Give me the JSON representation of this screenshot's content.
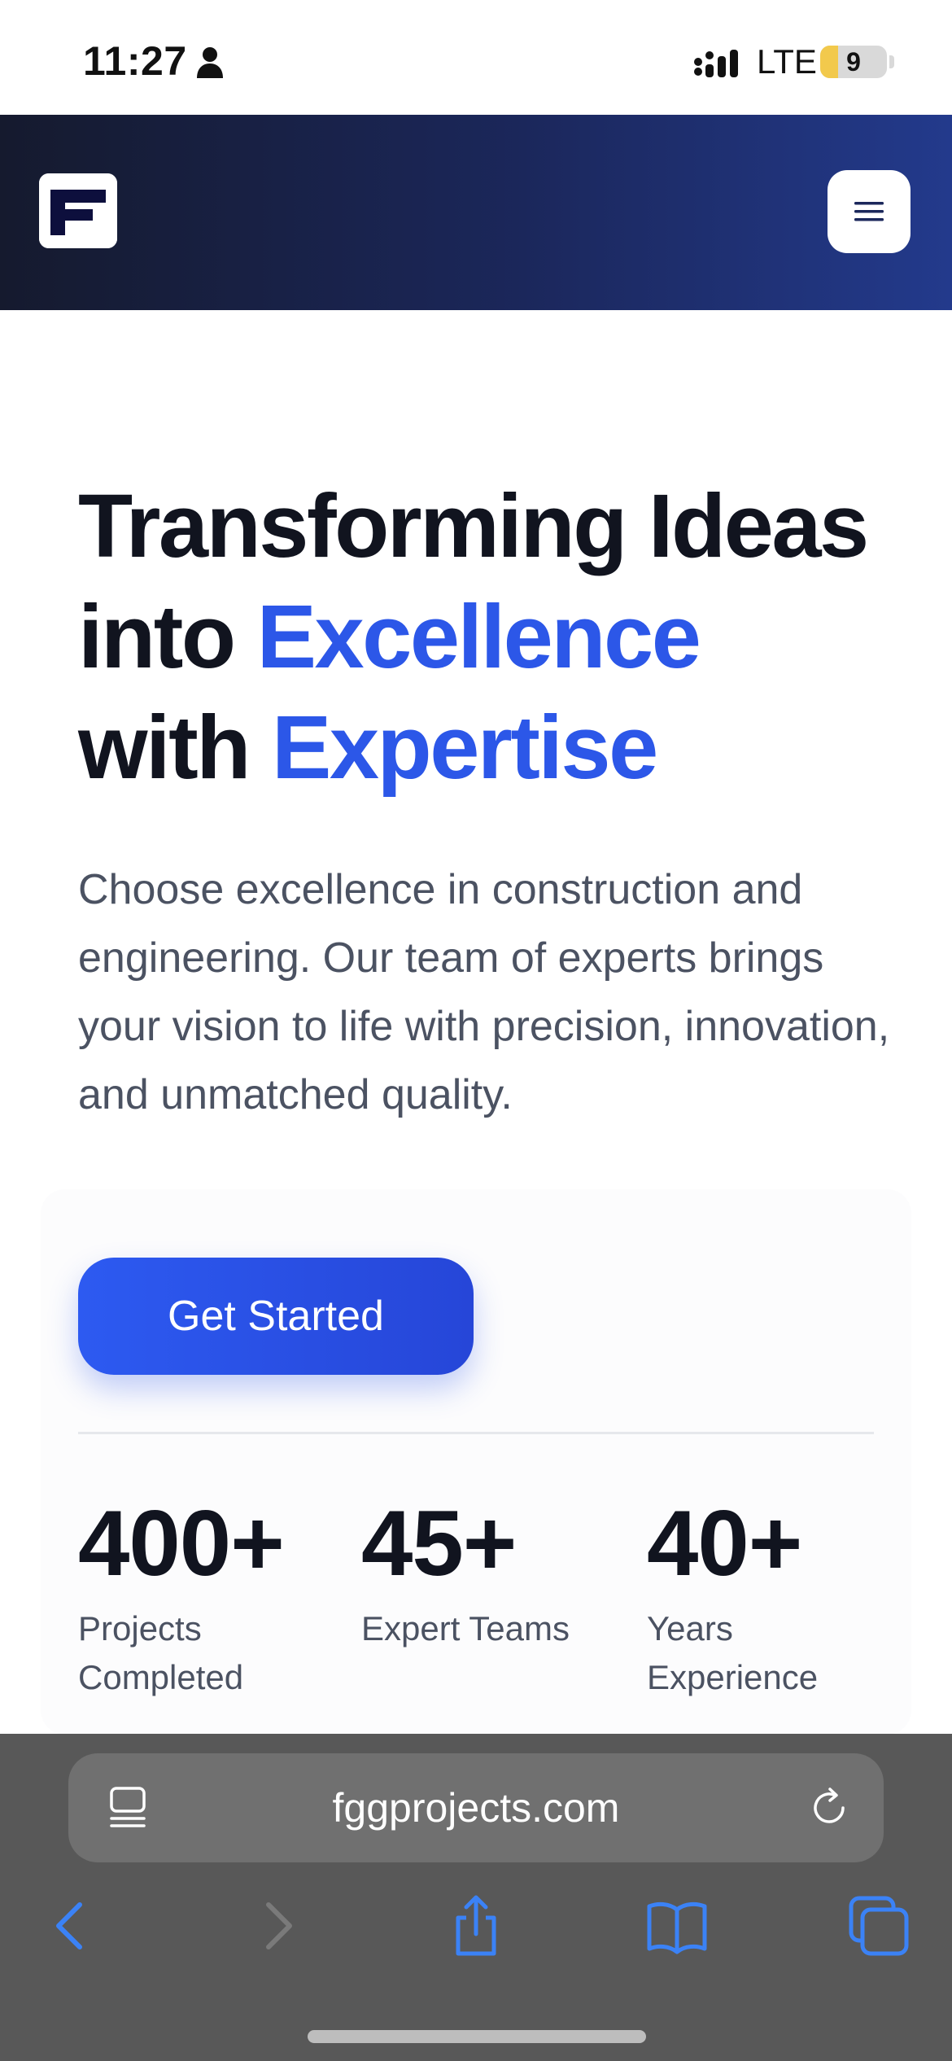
{
  "status_bar": {
    "time": "11:27",
    "network": "LTE",
    "battery_level": "9",
    "battery_fraction": 0.09,
    "battery_color": "#f2c94c"
  },
  "header": {
    "logo_icon": "fgg-logo-icon",
    "menu_icon": "hamburger-menu-icon",
    "gradient": [
      "#151a2e",
      "#233a8c"
    ]
  },
  "hero": {
    "title_line1": "Transforming Ideas",
    "title_line2_plain": "into ",
    "title_line2_accent": "Excellence",
    "title_line3_plain": "with ",
    "title_line3_accent": "Expertise",
    "description": "Choose excellence in construction and engineering. Our team of experts brings your vision to life with precision, innovation, and unmatched quality.",
    "cta_label": "Get Started",
    "accent_color": "#2c57e8"
  },
  "stats": [
    {
      "value": "400+",
      "label": "Projects Completed"
    },
    {
      "value": "45+",
      "label": "Expert Teams"
    },
    {
      "value": "40+",
      "label": "Years Experience"
    }
  ],
  "browser": {
    "url": "fggprojects.com",
    "icons": [
      "reader-icon",
      "reload-icon",
      "back-icon",
      "forward-icon",
      "share-icon",
      "bookmarks-icon",
      "tabs-icon"
    ],
    "icon_color": "#3b82f6"
  }
}
